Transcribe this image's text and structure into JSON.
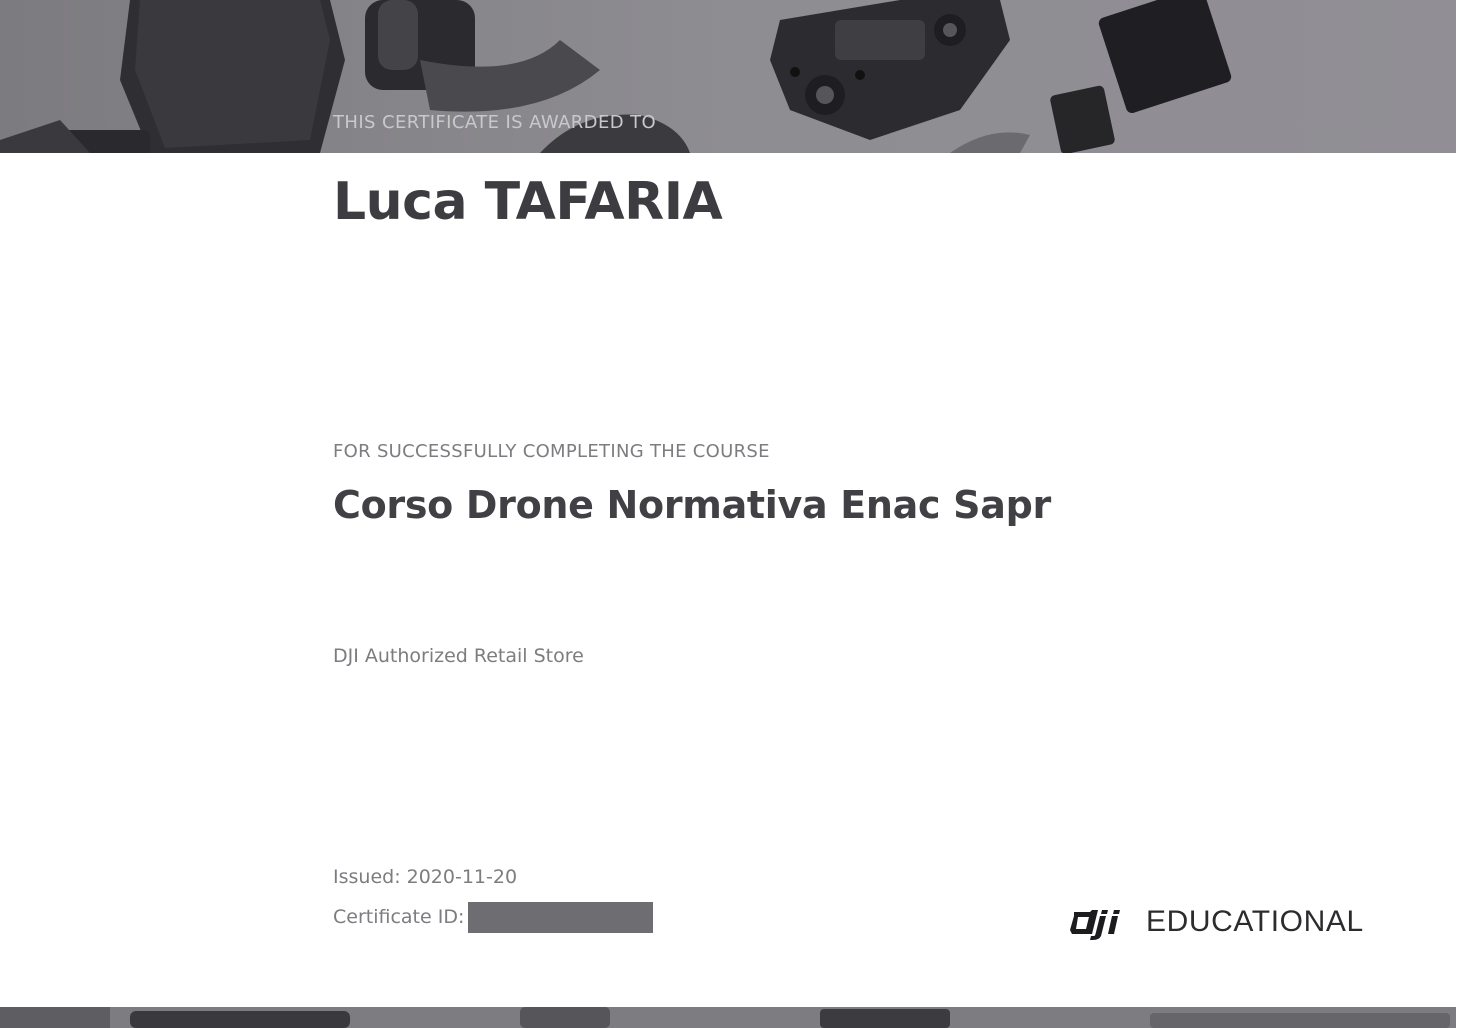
{
  "certificate": {
    "awarded_label": "THIS CERTIFICATE IS AWARDED TO",
    "recipient_name": "Luca TAFARIA",
    "course_label": "FOR SUCCESSFULLY COMPLETING THE COURSE",
    "course_name": "Corso Drone Normativa Enac Sapr",
    "issuer": "DJI Authorized Retail Store",
    "issued_text": "Issued: 2020-11-20",
    "certificate_id_label": "Certificate ID:"
  },
  "logo": {
    "mark": "dji",
    "text": "EDUCATIONAL"
  },
  "colors": {
    "banner": "#87868b",
    "text_dark": "#3d3c40",
    "text_muted": "#7d7c80",
    "redaction": "#6e6d72"
  },
  "icons": {
    "banner_top": "drone-accessories-photo",
    "banner_bottom": "drone-accessories-photo",
    "logo_mark": "dji-logo-icon"
  }
}
